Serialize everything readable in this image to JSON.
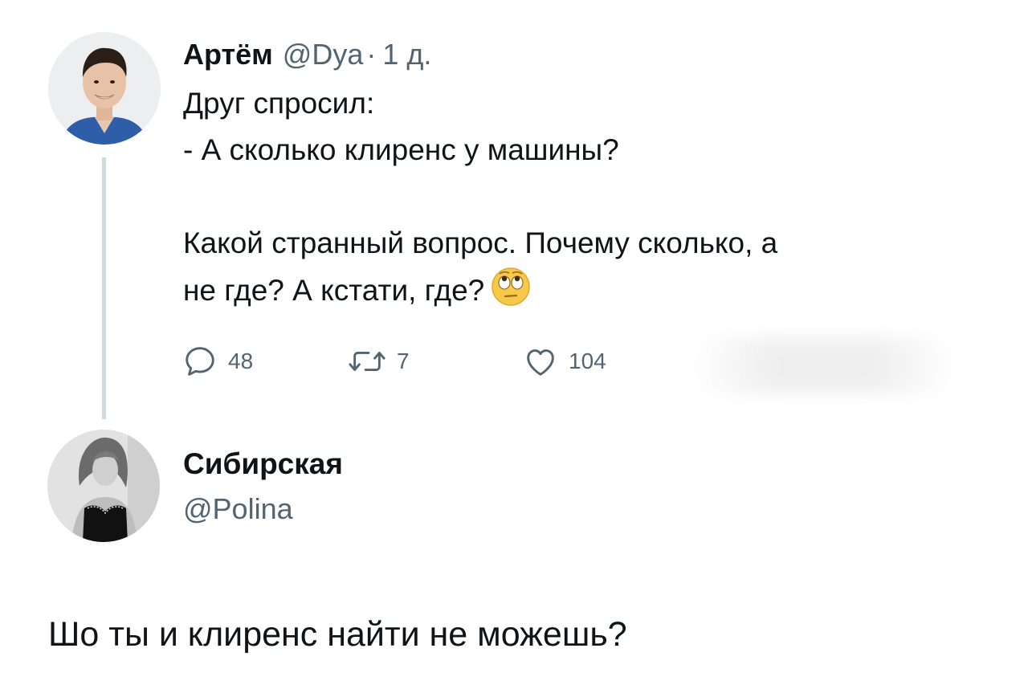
{
  "tweet": {
    "author": {
      "display_name": "Артём",
      "handle": "@Dya",
      "separator": "·",
      "time": "1 д."
    },
    "text_lines": [
      "Друг спросил:",
      "- А сколько клиренс у машины?",
      "Какой странный вопрос. Почему сколько, а",
      "не где? А кстати, где?"
    ],
    "emoji": "face-with-rolling-eyes",
    "stats": {
      "replies": "48",
      "retweets": "7",
      "likes": "104"
    }
  },
  "reply": {
    "author": {
      "display_name": "Сибирская",
      "handle": "@Polina"
    },
    "text": "Шо ты и клиренс найти не можешь?"
  }
}
